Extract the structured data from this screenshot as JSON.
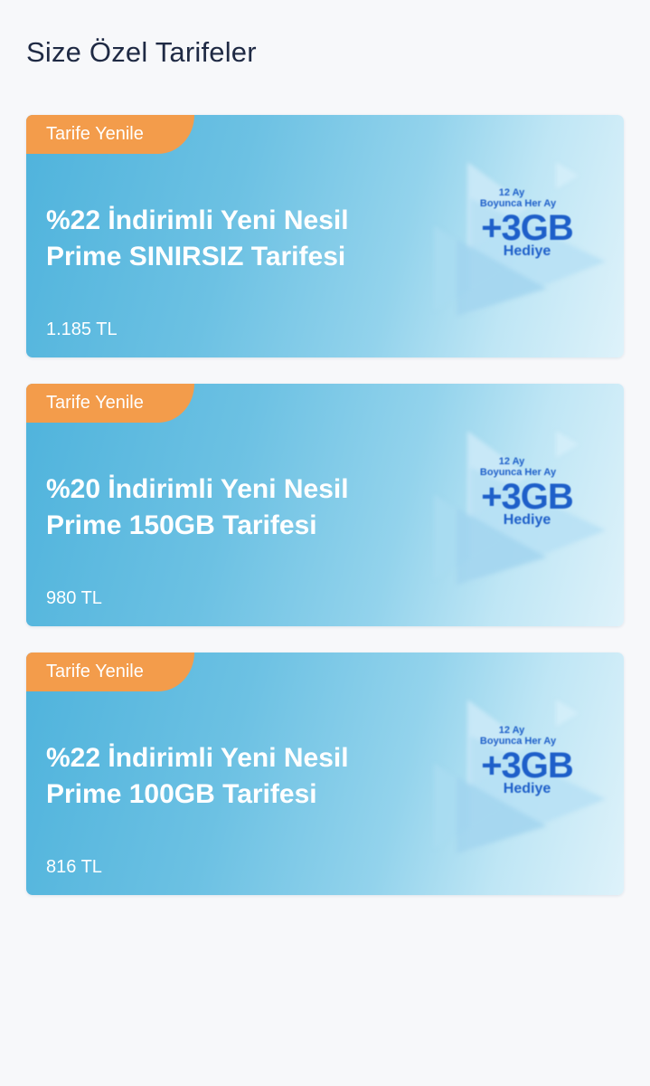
{
  "page": {
    "title": "Size Özel Tarifeler"
  },
  "promo": {
    "line1": "12 Ay",
    "line2": "Boyunca Her Ay",
    "line3": "+3GB",
    "line4": "Hediye"
  },
  "colors": {
    "ribbon": "#f39c4b",
    "card_gradient_start": "#4fb3dc",
    "card_gradient_end": "#def2fa",
    "promo_text": "#1e5fc9",
    "page_title": "#1f2a44"
  },
  "tariffs": [
    {
      "badge": "Tarife Yenile",
      "title_line1": "%22 İndirimli Yeni Nesil",
      "title_line2": "Prime SINIRSIZ Tarifesi",
      "price": "1.185 TL"
    },
    {
      "badge": "Tarife Yenile",
      "title_line1": "%20 İndirimli Yeni Nesil",
      "title_line2": "Prime 150GB Tarifesi",
      "price": "980 TL"
    },
    {
      "badge": "Tarife Yenile",
      "title_line1": "%22 İndirimli Yeni Nesil",
      "title_line2": "Prime 100GB Tarifesi",
      "price": "816 TL"
    }
  ]
}
